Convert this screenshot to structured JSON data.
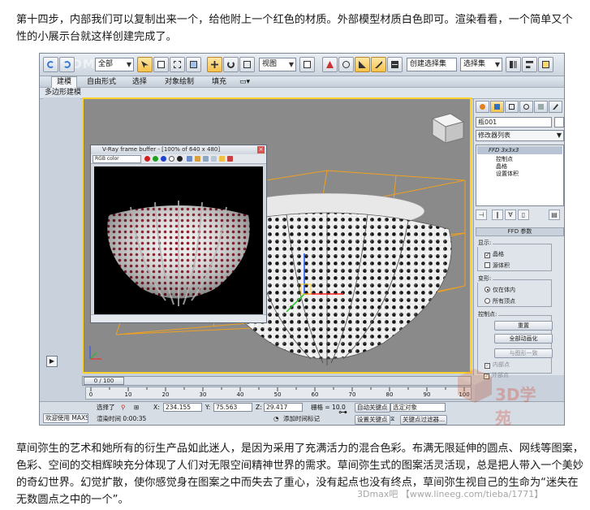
{
  "article": {
    "para_top": "第十四步，内部我们可以复制出来一个，给他附上一个红色的材质。外部模型材质白色即可。渲染看看，一个简单又个性的小展示台就这样创建完成了。",
    "para_bottom": "草间弥生的艺术和她所有的衍生产品如此迷人，是因为采用了充满活力的混合色彩。布满无限延伸的圆点、网线等图案，色彩、空间的交相辉映充分体现了人们对无限空间精神世界的需求。草间弥生式的图案活灵活现，总是把人带入一个美妙的奇幻世界。幻觉扩散，使你感觉身在图案之中而失去了重心，没有起点也没有终点，草间弥生视自己的生命为“迷失在无数圆点之中的一个”。"
  },
  "watermarks": {
    "top": "3DMAX",
    "url": "3Dmax吧 【www.lineeg.com/tieba/1771】",
    "logo": "3D学苑"
  },
  "toolbar": {
    "filter_select": "全部",
    "view_select": "视图",
    "named_selection": "创建选择集",
    "selection_dropdown": "选择集"
  },
  "ribbon": {
    "tabs": [
      "建模",
      "自由形式",
      "选择",
      "对象绘制",
      "填充"
    ],
    "active_tab": "建模",
    "sub_label": "多边形建模"
  },
  "frame_buffer": {
    "title": "V-Ray frame buffer - [100% of 640 x 480]",
    "channel": "RGB color"
  },
  "command_panel": {
    "object_name": "瓶001",
    "modifier_list": "修改器列表",
    "stack_head": "FFD 3x3x3",
    "stack_items": [
      "控制点",
      "晶格",
      "设置体积"
    ],
    "rollout_title": "FFD 参数",
    "display_group": "显示:",
    "display_options": [
      {
        "label": "晶格",
        "checked": true
      },
      {
        "label": "源体积",
        "checked": false
      }
    ],
    "deform_group": "变形:",
    "deform_options": [
      {
        "label": "仅在体内",
        "selected": true
      },
      {
        "label": "所有顶点",
        "selected": false
      }
    ],
    "control_group": "控制点:",
    "buttons": [
      "重置",
      "全部动画化",
      "与图形一致"
    ],
    "disabled_checks": [
      "内部点",
      "外部点"
    ]
  },
  "timeline": {
    "thumb": "0 / 100",
    "ticks": [
      "0",
      "10",
      "20",
      "30",
      "40",
      "50",
      "60",
      "70",
      "80",
      "90",
      "100"
    ]
  },
  "status_bar": {
    "welcome": "欢迎使用 MAXSc",
    "select_label": "选择了",
    "x_label": "X:",
    "x_value": "234.155",
    "y_label": "Y:",
    "y_value": "75.563",
    "z_label": "Z:",
    "z_value": "29.417",
    "grid_label": "栅格 = 10.0",
    "render_time": "渲染时间  0:00:35",
    "add_time_tag": "添加时间标记",
    "auto_key": "自动关键点",
    "selected_object": "选定对象",
    "set_key": "设置关键点",
    "key_filter": "关键点过滤器..."
  },
  "colors": {
    "viewport_border": "#ffd22a",
    "viewport_bg": "#8a8a8a",
    "lattice": "#f0a020",
    "polka_dot": "#8a1020",
    "active_button": "#f6c34a"
  }
}
